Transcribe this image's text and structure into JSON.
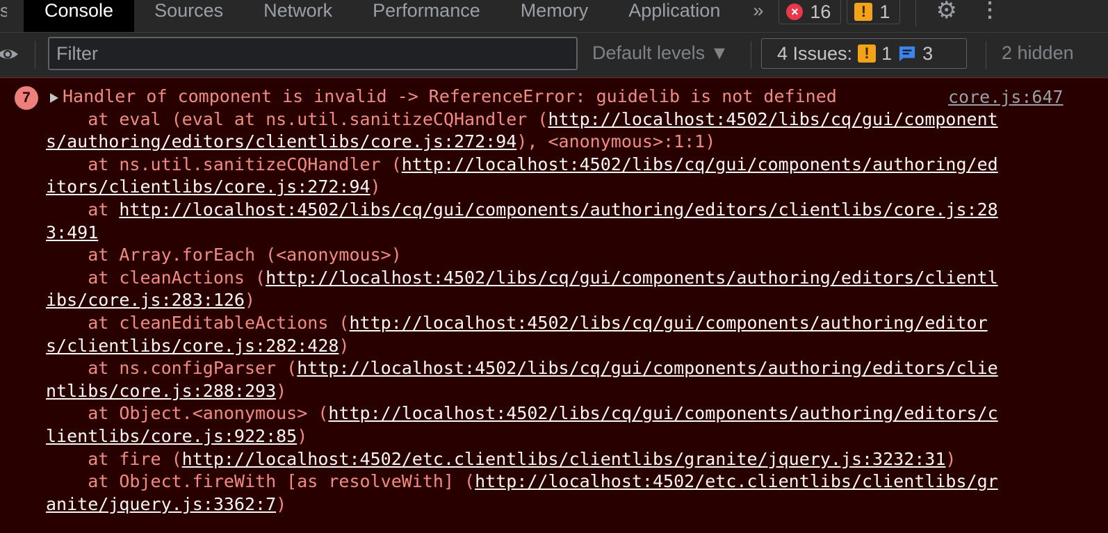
{
  "tabs": {
    "edge_fragment": "s",
    "items": [
      {
        "label": "Console",
        "active": true
      },
      {
        "label": "Sources",
        "active": false
      },
      {
        "label": "Network",
        "active": false
      },
      {
        "label": "Performance",
        "active": false
      },
      {
        "label": "Memory",
        "active": false
      },
      {
        "label": "Application",
        "active": false
      }
    ],
    "more": "»",
    "error_count": "16",
    "warning_count": "1"
  },
  "filterbar": {
    "filter_placeholder": "Filter",
    "levels_label": "Default levels ▼",
    "issues_label": "4 Issues:",
    "issues_warning_count": "1",
    "issues_info_count": "3",
    "hidden_label": "2 hidden"
  },
  "console": {
    "repeat_count": "7",
    "source": "core.js:647",
    "lines": [
      {
        "t": "Handler of component is invalid -> ReferenceError: guidelib is not defined"
      },
      {
        "a": "    at eval (eval at ns.util.sanitizeCQHandler (",
        "link": "http://localhost:4502/libs/cq/gui/component"
      },
      {
        "link": "s/authoring/editors/clientlibs/core.js:272:94",
        "b": "), <anonymous>:1:1)"
      },
      {
        "a": "    at ns.util.sanitizeCQHandler (",
        "link": "http://localhost:4502/libs/cq/gui/components/authoring/ed"
      },
      {
        "link": "itors/clientlibs/core.js:272:94",
        "b": ")"
      },
      {
        "a": "    at ",
        "link": "http://localhost:4502/libs/cq/gui/components/authoring/editors/clientlibs/core.js:28"
      },
      {
        "link": "3:491"
      },
      {
        "a": "    at Array.forEach (<anonymous>)"
      },
      {
        "a": "    at cleanActions (",
        "link": "http://localhost:4502/libs/cq/gui/components/authoring/editors/clientl"
      },
      {
        "link": "ibs/core.js:283:126",
        "b": ")"
      },
      {
        "a": "    at cleanEditableActions (",
        "link": "http://localhost:4502/libs/cq/gui/components/authoring/editor"
      },
      {
        "link": "s/clientlibs/core.js:282:428",
        "b": ")"
      },
      {
        "a": "    at ns.configParser (",
        "link": "http://localhost:4502/libs/cq/gui/components/authoring/editors/clie"
      },
      {
        "link": "ntlibs/core.js:288:293",
        "b": ")"
      },
      {
        "a": "    at Object.<anonymous> (",
        "link": "http://localhost:4502/libs/cq/gui/components/authoring/editors/c"
      },
      {
        "link": "lientlibs/core.js:922:85",
        "b": ")"
      },
      {
        "a": "    at fire (",
        "link": "http://localhost:4502/etc.clientlibs/clientlibs/granite/jquery.js:3232:31",
        "b": ")"
      },
      {
        "a": "    at Object.fireWith [as resolveWith] (",
        "link": "http://localhost:4502/etc.clientlibs/clientlibs/gr"
      },
      {
        "link": "anite/jquery.js:3362:7",
        "b": ")"
      }
    ]
  },
  "icons": {
    "error": "×",
    "warning": "!",
    "gear": "⚙",
    "kebab": "⋮"
  }
}
